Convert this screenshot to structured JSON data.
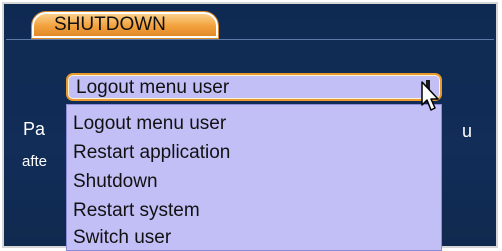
{
  "dialog": {
    "title": "SHUTDOWN",
    "background_text": [
      "Pa",
      "u",
      "afte"
    ]
  },
  "select": {
    "value": "Logout menu user",
    "options": [
      "Logout menu user",
      "Restart application",
      "Shutdown",
      "Restart system",
      "Switch user"
    ]
  },
  "colors": {
    "dialog_bg": "#112d58",
    "title_tab": "#f2a13c",
    "select_bg": "#c2bff7",
    "select_border": "#e89a2e"
  },
  "icons": {
    "cursor": "mouse-pointer-icon",
    "dropdown": "dropdown-arrow-icon"
  }
}
